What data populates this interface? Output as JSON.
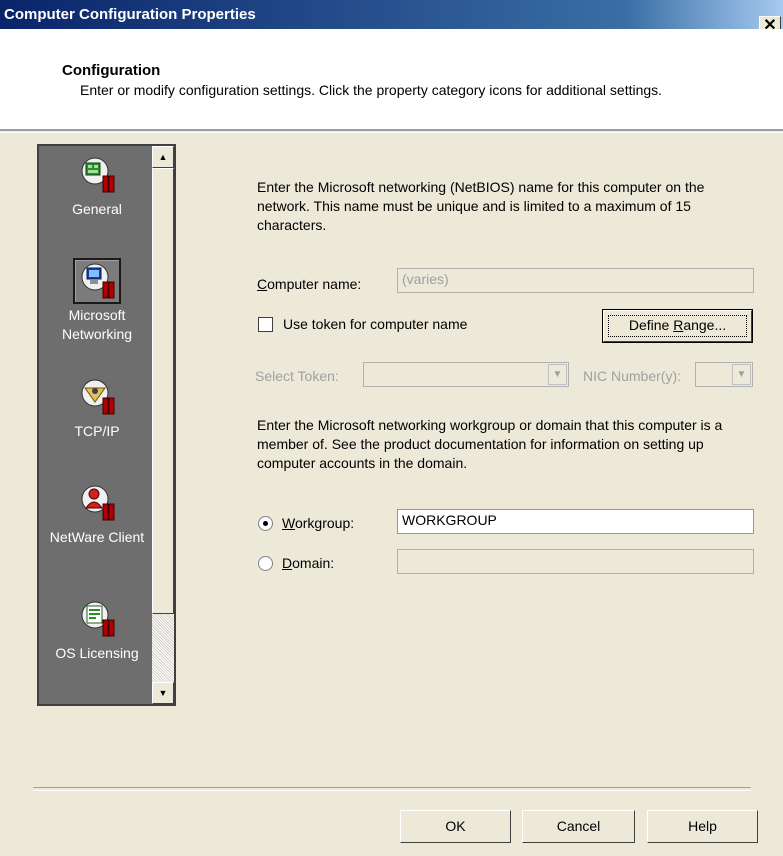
{
  "window": {
    "title": "Computer Configuration Properties",
    "close_glyph": "✕"
  },
  "header": {
    "title": "Configuration",
    "description": "Enter or modify configuration settings. Click the property category icons for additional settings."
  },
  "sidebar": {
    "items": [
      {
        "label": "General",
        "icon": "computer-config-icon"
      },
      {
        "label": "Microsoft Networking",
        "icon": "network-computer-icon"
      },
      {
        "label": "TCP/IP",
        "icon": "tcpip-icon"
      },
      {
        "label": "NetWare Client",
        "icon": "netware-client-icon"
      },
      {
        "label": "OS Licensing",
        "icon": "licensing-icon"
      }
    ],
    "selected": "Microsoft Networking"
  },
  "main": {
    "netbios_desc": "Enter the Microsoft networking (NetBIOS) name for this computer on the network. This name must be unique and is limited to a maximum of 15 characters.",
    "computer_name_label": "Computer name:",
    "computer_name_value": "(varies)",
    "use_token_label": "Use token for computer name",
    "use_token_checked": false,
    "define_range_label": "Define Range...",
    "select_token_label": "Select Token:",
    "nic_number_label": "NIC Number(y):",
    "workgroup_desc": "Enter the Microsoft networking workgroup or domain that this computer is a member of. See the product documentation for information on setting up computer accounts in the domain.",
    "workgroup_label": "Workgroup:",
    "workgroup_value": "WORKGROUP",
    "domain_label": "Domain:",
    "domain_value": "",
    "membership_selected": "Workgroup"
  },
  "footer": {
    "ok_label": "OK",
    "cancel_label": "Cancel",
    "help_label": "Help"
  }
}
